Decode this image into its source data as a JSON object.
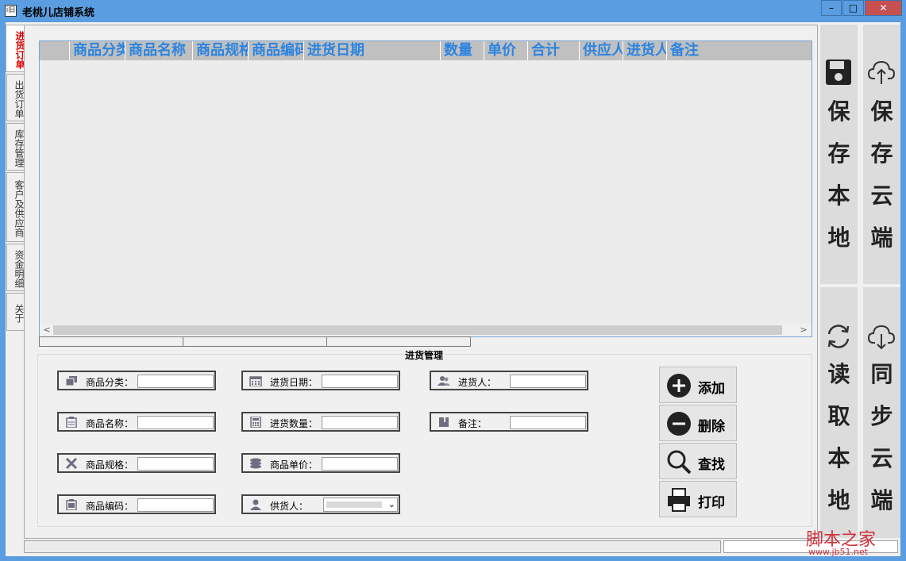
{
  "window": {
    "title": "老桃儿店铺系统",
    "app_icon_text": "i旧",
    "min_label": "–",
    "max_label": "□",
    "close_label": "✕"
  },
  "tabs": [
    {
      "label": "进货订单",
      "active": true
    },
    {
      "label": "出货订单",
      "active": false
    },
    {
      "label": "库存管理",
      "active": false
    },
    {
      "label": "客户及供应商",
      "active": false
    },
    {
      "label": "资金明细",
      "active": false
    },
    {
      "label": "关于",
      "active": false
    }
  ],
  "grid": {
    "columns": [
      "",
      "商品分类",
      "商品名称",
      "商品规格",
      "商品编码",
      "进货日期",
      "数量",
      "单价",
      "合计",
      "供应人",
      "进货人",
      "备注"
    ]
  },
  "groupbox": {
    "title": "进货管理"
  },
  "fields": {
    "category": {
      "label": "商品分类：",
      "icon": "layers-icon",
      "value": ""
    },
    "name": {
      "label": "商品名称：",
      "icon": "clipboard-icon",
      "value": ""
    },
    "spec": {
      "label": "商品规格：",
      "icon": "tools-icon",
      "value": ""
    },
    "code": {
      "label": "商品编码：",
      "icon": "barcode-box-icon",
      "value": ""
    },
    "date": {
      "label": "进货日期：",
      "icon": "calendar-icon",
      "value": ""
    },
    "qty": {
      "label": "进货数量：",
      "icon": "calculator-icon",
      "value": ""
    },
    "price": {
      "label": "商品单价：",
      "icon": "coins-icon",
      "value": ""
    },
    "supplier": {
      "label": "供货人：",
      "icon": "person-icon",
      "value": ""
    },
    "buyer": {
      "label": "进货人：",
      "icon": "users-icon",
      "value": ""
    },
    "note": {
      "label": "备注：",
      "icon": "book-icon",
      "value": ""
    }
  },
  "actions": {
    "add": "添加",
    "delete": "删除",
    "search": "查找",
    "print": "打印"
  },
  "side_buttons": {
    "save_local": [
      "保",
      "存",
      "本",
      "地"
    ],
    "save_cloud": [
      "保",
      "存",
      "云",
      "端"
    ],
    "read_local": [
      "读",
      "取",
      "本",
      "地"
    ],
    "sync_cloud": [
      "同",
      "步",
      "云",
      "端"
    ]
  },
  "watermark": {
    "text": "脚本之家",
    "url": "www.jb51.net"
  },
  "colors": {
    "titlebar": "#5a9de0",
    "header_text": "#2c84e0",
    "active_tab_text": "#dd0000"
  }
}
